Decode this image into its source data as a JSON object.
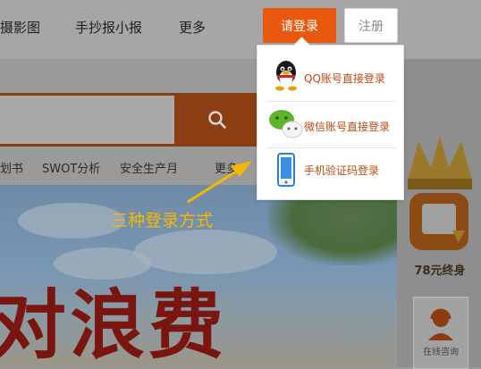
{
  "nav": {
    "items": [
      "摄影图",
      "手抄报小报",
      "更多"
    ],
    "login_label": "请登录",
    "register_label": "注册"
  },
  "tags": [
    "划书",
    "SWOT分析",
    "安全生产月",
    "更多"
  ],
  "banner": {
    "text": "对浪费"
  },
  "sidebar": {
    "price_label": "78元终身",
    "online_label": "在线咨询"
  },
  "login_menu": {
    "options": [
      {
        "label": "QQ账号直接登录",
        "icon": "qq-penguin-icon"
      },
      {
        "label": "微信账号直接登录",
        "icon": "wechat-icon"
      },
      {
        "label": "手机验证码登录",
        "icon": "phone-icon"
      }
    ]
  },
  "annotation": {
    "text": "三种登录方式"
  },
  "colors": {
    "accent": "#e8580d",
    "link": "#b94a12",
    "annotation": "#f5b800"
  }
}
